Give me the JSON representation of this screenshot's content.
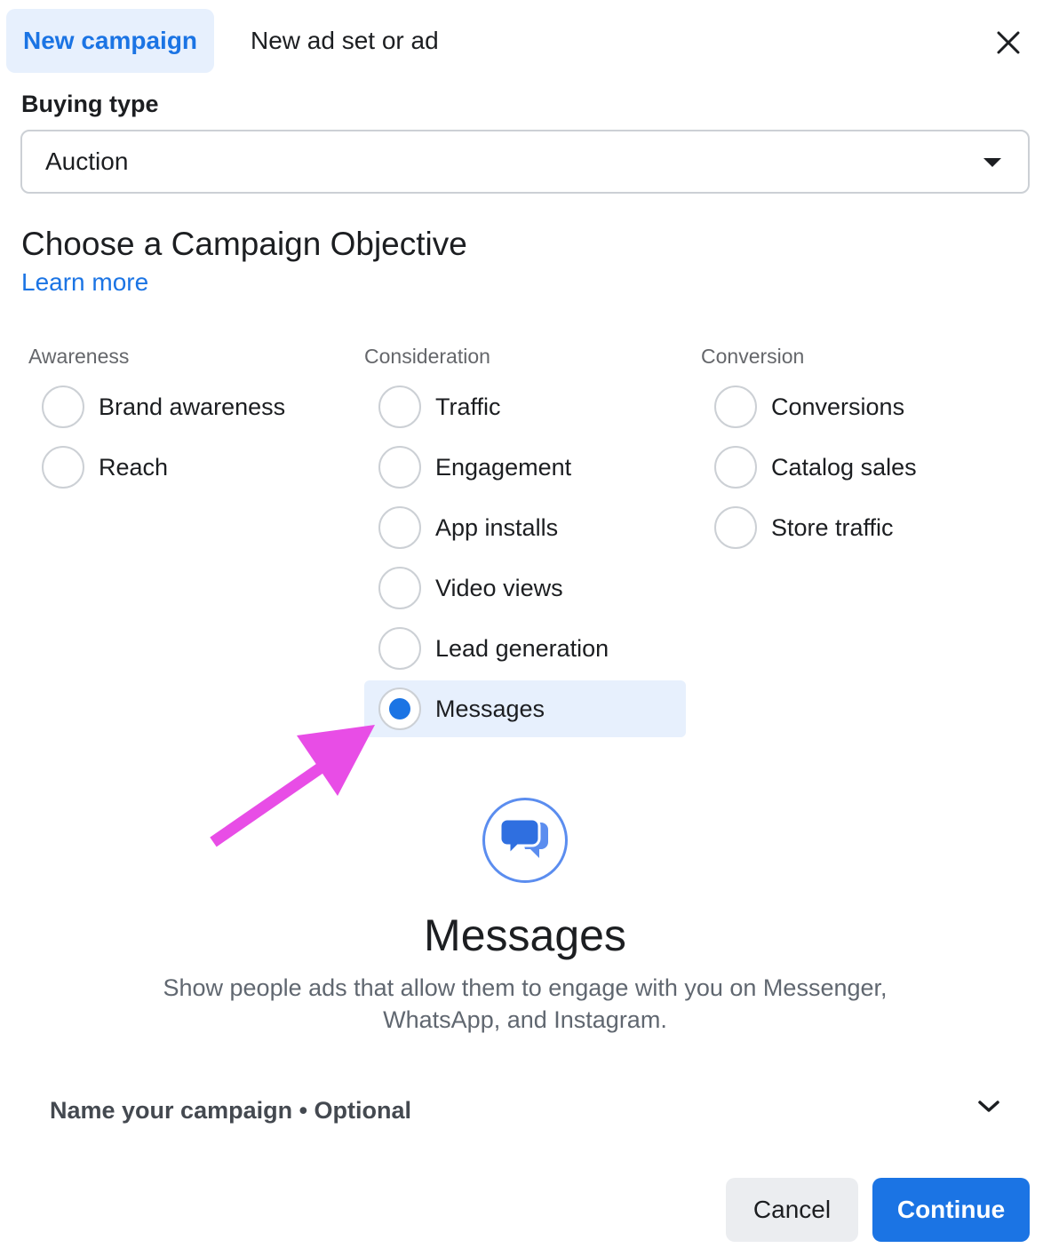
{
  "tabs": {
    "active": "New campaign",
    "inactive": "New ad set or ad"
  },
  "buying_type": {
    "label": "Buying type",
    "value": "Auction"
  },
  "objective": {
    "heading": "Choose a Campaign Objective",
    "learn_more": "Learn more",
    "columns": [
      {
        "header": "Awareness",
        "options": [
          "Brand awareness",
          "Reach"
        ]
      },
      {
        "header": "Consideration",
        "options": [
          "Traffic",
          "Engagement",
          "App installs",
          "Video views",
          "Lead generation",
          "Messages"
        ]
      },
      {
        "header": "Conversion",
        "options": [
          "Conversions",
          "Catalog sales",
          "Store traffic"
        ]
      }
    ],
    "selected": "Messages"
  },
  "detail": {
    "icon": "messenger-chat-icon",
    "title": "Messages",
    "description_line1": "Show people ads that allow them to engage with you on Messenger,",
    "description_line2": "WhatsApp, and Instagram."
  },
  "name_campaign": {
    "label": "Name your campaign • Optional"
  },
  "buttons": {
    "cancel": "Cancel",
    "continue": "Continue"
  },
  "colors": {
    "accent": "#1b74e4",
    "selected_bg": "#e7f0fd",
    "annotation_arrow": "#e84de6"
  }
}
